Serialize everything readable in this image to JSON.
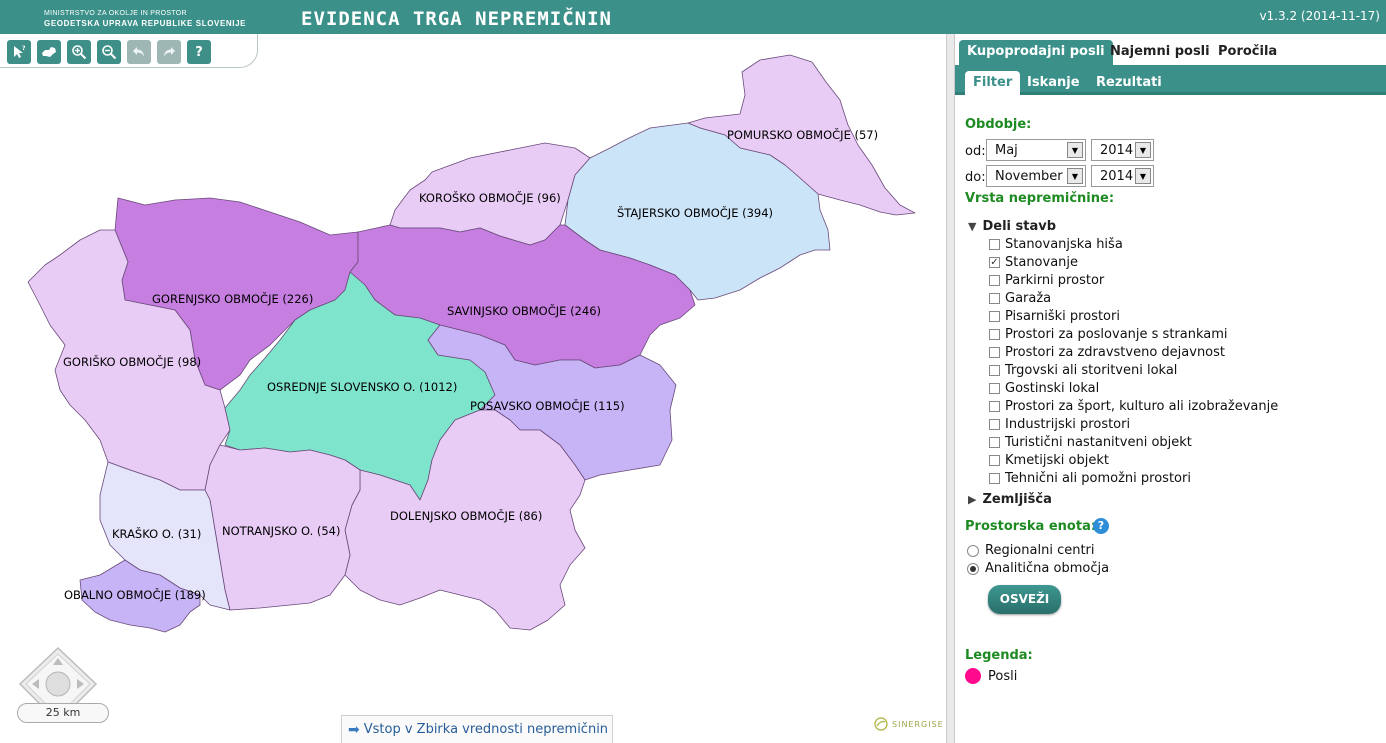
{
  "header": {
    "ministry_line1": "MINISTRSTVO ZA OKOLJE IN PROSTOR",
    "ministry_line2": "GEODETSKA UPRAVA REPUBLIKE SLOVENIJE",
    "app_title": "EVIDENCA TRGA NEPREMIČNIN",
    "version": "v1.3.2 (2014-11-17)"
  },
  "toolbar": {
    "icons": [
      "info-cursor-icon",
      "map-extent-icon",
      "zoom-in-icon",
      "zoom-out-icon",
      "undo-icon",
      "redo-icon",
      "help-icon"
    ],
    "help_label": "?"
  },
  "map": {
    "regions": [
      {
        "name": "POMURSKO OBMOČJE",
        "count": 57,
        "label": "POMURSKO OBMOČJE (57)",
        "color": "#e8ccf6"
      },
      {
        "name": "KOROŠKO OBMOČJE",
        "count": 96,
        "label": "KOROŠKO OBMOČJE (96)",
        "color": "#e8ccf6"
      },
      {
        "name": "ŠTAJERSKO OBMOČJE",
        "count": 394,
        "label": "ŠTAJERSKO OBMOČJE (394)",
        "color": "#cce4f8"
      },
      {
        "name": "GORENJSKO OBMOČJE",
        "count": 226,
        "label": "GORENJSKO OBMOČJE (226)",
        "color": "#c67ee0"
      },
      {
        "name": "SAVINJSKO OBMOČJE",
        "count": 246,
        "label": "SAVINJSKO OBMOČJE (246)",
        "color": "#c67ee0"
      },
      {
        "name": "GORIŠKO OBMOČJE",
        "count": 98,
        "label": "GORIŠKO OBMOČJE (98)",
        "color": "#e8ccf6"
      },
      {
        "name": "OSREDNJE SLOVENSKO O.",
        "count": 1012,
        "label": "OSREDNJE SLOVENSKO O. (1012)",
        "color": "#7fe4cc"
      },
      {
        "name": "POSAVSKO OBMOČJE",
        "count": 115,
        "label": "POSAVSKO  OBMOČJE (115)",
        "color": "#c6b4f6"
      },
      {
        "name": "KRAŠKO O.",
        "count": 31,
        "label": "KRAŠKO O. (31)",
        "color": "#e4e4fa"
      },
      {
        "name": "NOTRANJSKO O.",
        "count": 54,
        "label": "NOTRANJSKO O. (54)",
        "color": "#e8ccf6"
      },
      {
        "name": "DOLENJSKO OBMOČJE",
        "count": 86,
        "label": "DOLENJSKO OBMOČJE (86)",
        "color": "#e8ccf6"
      },
      {
        "name": "OBALNO OBMOČJE",
        "count": 189,
        "label": "OBALNO OBMOČJE (189)",
        "color": "#c6b4f6"
      }
    ],
    "scale_label": "25 km",
    "entry_link": "Vstop v Zbirka vrednosti nepremičnin",
    "brand": "SINERGISE"
  },
  "panel": {
    "main_tabs": [
      "Kupoprodajni posli",
      "Najemni posli",
      "Poročila"
    ],
    "active_main_tab": "Kupoprodajni posli",
    "sub_tabs": [
      "Filter",
      "Iskanje",
      "Rezultati"
    ],
    "active_sub_tab": "Filter",
    "period": {
      "label": "Obdobje:",
      "from_label": "od:",
      "from_month": "Maj",
      "from_year": "2014",
      "to_label": "do:",
      "to_month": "November",
      "to_year": "2014"
    },
    "property_type": {
      "label": "Vrsta nepremičnine:",
      "group_buildings": "Deli stavb",
      "items": [
        {
          "label": "Stanovanjska hiša",
          "checked": false
        },
        {
          "label": "Stanovanje",
          "checked": true
        },
        {
          "label": "Parkirni prostor",
          "checked": false
        },
        {
          "label": "Garaža",
          "checked": false
        },
        {
          "label": "Pisarniški prostori",
          "checked": false
        },
        {
          "label": "Prostori za poslovanje s strankami",
          "checked": false
        },
        {
          "label": "Prostori za zdravstveno dejavnost",
          "checked": false
        },
        {
          "label": "Trgovski ali storitveni lokal",
          "checked": false
        },
        {
          "label": "Gostinski lokal",
          "checked": false
        },
        {
          "label": "Prostori za šport, kulturo ali izobraževanje",
          "checked": false
        },
        {
          "label": "Industrijski prostori",
          "checked": false
        },
        {
          "label": "Turistični nastanitveni objekt",
          "checked": false
        },
        {
          "label": "Kmetijski objekt",
          "checked": false
        },
        {
          "label": "Tehnični ali pomožni prostori",
          "checked": false
        }
      ],
      "group_land": "Zemljišča"
    },
    "spatial_unit": {
      "label": "Prostorska enota:",
      "help": "?",
      "options": [
        {
          "label": "Regionalni centri",
          "selected": false
        },
        {
          "label": "Analitična območja",
          "selected": true
        }
      ]
    },
    "refresh_label": "OSVEŽI",
    "legend": {
      "label": "Legenda:",
      "item": "Posli",
      "color": "#ff0a8c"
    }
  }
}
